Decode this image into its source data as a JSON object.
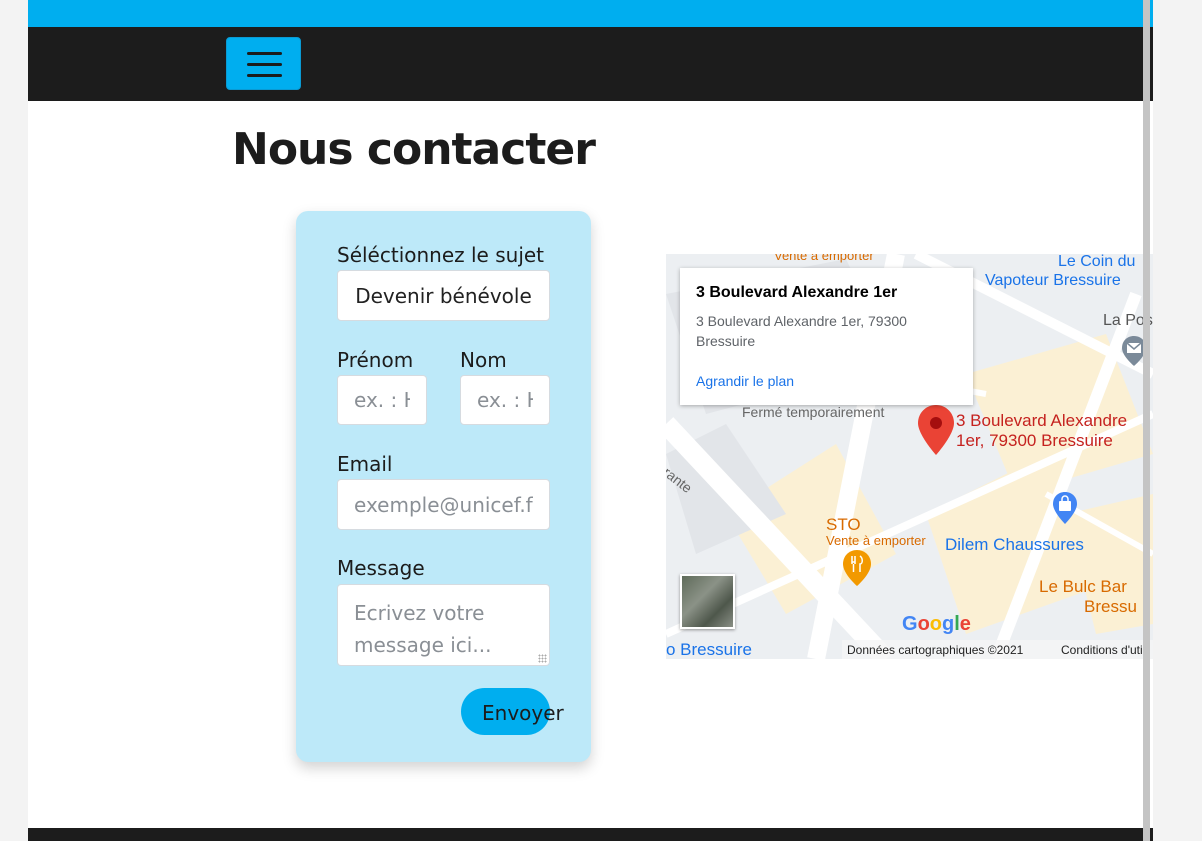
{
  "page": {
    "title": "Nous contacter"
  },
  "colors": {
    "accent": "#00aeef",
    "card": "#bde9f9",
    "dark": "#1c1c1c"
  },
  "navbar": {
    "menu_icon": "hamburger-icon"
  },
  "form": {
    "subject_label": "Séléctionnez le sujet",
    "subject_value": "Devenir bénévole",
    "firstname_label": "Prénom",
    "firstname_placeholder": "ex. : H",
    "lastname_label": "Nom",
    "lastname_placeholder": "ex. : H",
    "email_label": "Email",
    "email_placeholder": "exemple@unicef.fr",
    "message_label": "Message",
    "message_placeholder": "Ecrivez votre message ici...",
    "submit_label": "Envoyer"
  },
  "map": {
    "info_title": "3 Boulevard Alexandre 1er",
    "info_address_line1": "3 Boulevard Alexandre 1er, 79300",
    "info_address_line2": "Bressuire",
    "enlarge_link": "Agrandir le plan",
    "marker_label_line1": "3 Boulevard Alexandre",
    "marker_label_line2": "1er, 79300 Bressuire",
    "places": {
      "vente_top": "Vente à emporter",
      "coin_line1": "Le Coin du",
      "coin_line2": "Vapoteur Bressuire",
      "la_pos": "La Pos",
      "ferme": "Fermé temporairement",
      "street": "arante",
      "sto": "STO",
      "vente_bottom": "Vente à emporter",
      "dilem": "Dilem Chaussures",
      "bulc_line1": "Le Bulc Bar",
      "bulc_line2": "Bressu",
      "bressuire": "o Bressuire"
    },
    "google": "Google",
    "copyright": "Données cartographiques ©2021",
    "terms": "Conditions d'uti"
  }
}
